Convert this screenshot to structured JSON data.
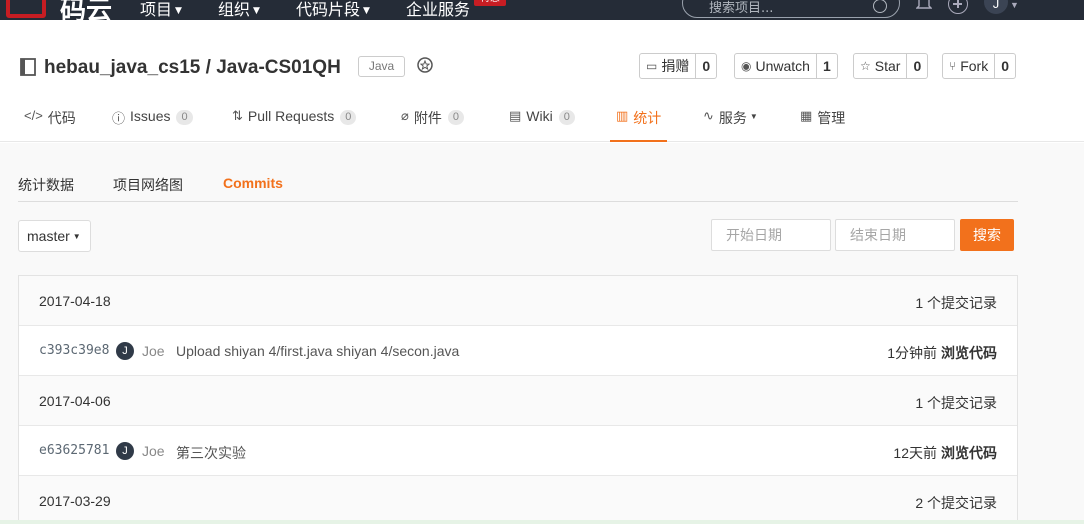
{
  "topnav": {
    "logo_text": "码云",
    "items": [
      "项目",
      "组织",
      "代码片段",
      "企业服务"
    ],
    "hot_badge": "特惠",
    "search_placeholder": "搜索项目...",
    "user_initial": "J"
  },
  "repo": {
    "owner": "hebau_java_cs15",
    "separator": "/",
    "name": "Java-CS01QH",
    "language": "Java"
  },
  "actions": {
    "donate": {
      "label": "捐赠",
      "count": "0"
    },
    "watch": {
      "label": "Unwatch",
      "count": "1"
    },
    "star": {
      "label": "Star",
      "count": "0"
    },
    "fork": {
      "label": "Fork",
      "count": "0"
    }
  },
  "tabs": [
    {
      "label": "代码",
      "icon": "code-icon"
    },
    {
      "label": "Issues",
      "count": "0",
      "icon": "issue-icon"
    },
    {
      "label": "Pull Requests",
      "count": "0",
      "icon": "pull-request-icon"
    },
    {
      "label": "附件",
      "count": "0",
      "icon": "paperclip-icon"
    },
    {
      "label": "Wiki",
      "count": "0",
      "icon": "book-icon"
    },
    {
      "label": "统计",
      "icon": "bar-chart-icon",
      "active": true
    },
    {
      "label": "服务",
      "icon": "pulse-icon"
    },
    {
      "label": "管理",
      "icon": "settings-doc-icon"
    }
  ],
  "subtabs": [
    "统计数据",
    "项目网络图",
    "Commits"
  ],
  "filters": {
    "branch": "master",
    "start_placeholder": "开始日期",
    "end_placeholder": "结束日期",
    "search_label": "搜索"
  },
  "commits": [
    {
      "date": "2017-04-18",
      "count_label": "1 个提交记录"
    },
    {
      "sha": "c393c39e8",
      "avatar": "J",
      "author": "Joe",
      "message": "Upload shiyan 4/first.java shiyan 4/secon.java",
      "time": "1分钟前",
      "browse": "浏览代码"
    },
    {
      "date": "2017-04-06",
      "count_label": "1 个提交记录"
    },
    {
      "sha": "e63625781",
      "avatar": "J",
      "author": "Joe",
      "message": "第三次实验",
      "time": "12天前",
      "browse": "浏览代码"
    },
    {
      "date": "2017-03-29",
      "count_label": "2 个提交记录"
    }
  ],
  "colors": {
    "nav_bg": "#252c37",
    "accent": "#f2711c",
    "brand_red": "#c71d23"
  }
}
